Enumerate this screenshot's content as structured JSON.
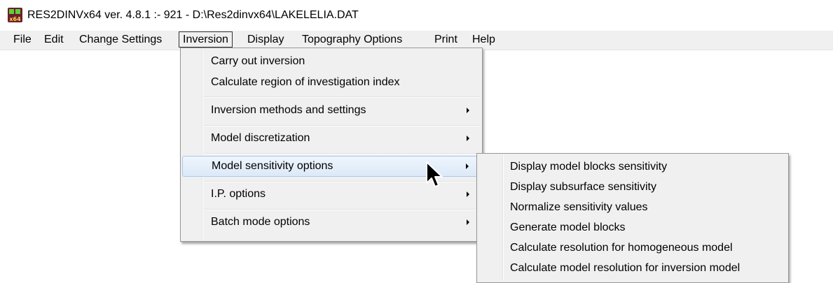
{
  "window": {
    "title": "RES2DINVx64 ver. 4.8.1 :- 921 - D:\\Res2dinvx64\\LAKELELIA.DAT",
    "icon_text": "x64",
    "icon_name": "app-logo-icon"
  },
  "menubar": {
    "items": [
      {
        "label": "File"
      },
      {
        "label": "Edit"
      },
      {
        "label": "Change Settings"
      },
      {
        "label": "Inversion",
        "active": true
      },
      {
        "label": "Display"
      },
      {
        "label": "Topography Options"
      },
      {
        "label": "Print"
      },
      {
        "label": "Help"
      }
    ]
  },
  "inversion_menu": {
    "items": [
      {
        "label": "Carry out inversion"
      },
      {
        "label": "Calculate region of investigation index"
      },
      {
        "label": "Inversion methods and settings",
        "has_submenu": true
      },
      {
        "label": "Model discretization",
        "has_submenu": true
      },
      {
        "label": "Model sensitivity options",
        "has_submenu": true,
        "highlighted": true
      },
      {
        "label": "I.P. options",
        "has_submenu": true
      },
      {
        "label": "Batch mode options",
        "has_submenu": true
      }
    ]
  },
  "sensitivity_submenu": {
    "items": [
      {
        "label": "Display model blocks sensitivity"
      },
      {
        "label": "Display subsurface sensitivity"
      },
      {
        "label": "Normalize sensitivity values"
      },
      {
        "label": "Generate model blocks"
      },
      {
        "label": "Calculate resolution for homogeneous model"
      },
      {
        "label": "Calculate model resolution for inversion model"
      }
    ]
  },
  "colors": {
    "menu_background": "#f0f0f0",
    "highlight_border": "#a8c8ec",
    "icon_background": "#6d1d2b",
    "icon_squares": "#5bd03a"
  }
}
